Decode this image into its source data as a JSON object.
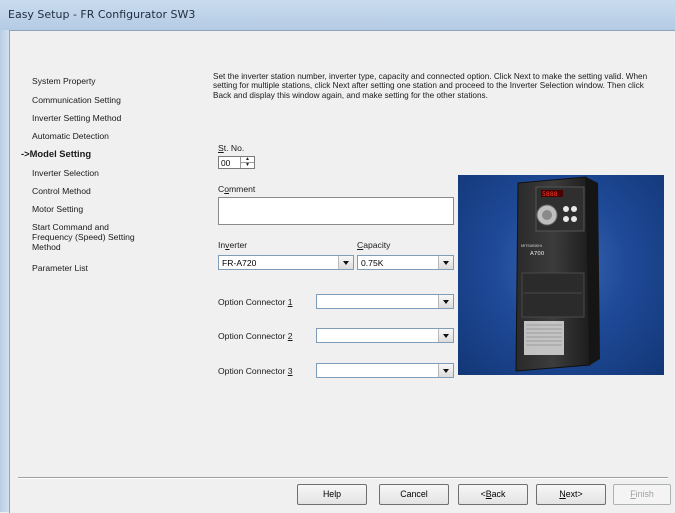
{
  "window": {
    "title": "Easy Setup - FR Configurator SW3"
  },
  "nav": {
    "items": [
      {
        "label": "System Property",
        "active": false
      },
      {
        "label": "Communication Setting",
        "active": false
      },
      {
        "label": "Inverter Setting Method",
        "active": false
      },
      {
        "label": "Automatic Detection",
        "active": false
      },
      {
        "label": "->Model Setting",
        "active": true
      },
      {
        "label": "Inverter Selection",
        "active": false
      },
      {
        "label": "Control Method",
        "active": false
      },
      {
        "label": "Motor Setting",
        "active": false
      },
      {
        "label": "Start Command and Frequency (Speed) Setting Method",
        "active": false
      },
      {
        "label": "Parameter List",
        "active": false
      }
    ]
  },
  "description": "Set the inverter station number, inverter type, capacity and connected option. Click Next to make the setting valid. When setting for multiple stations, click Next after setting one station and proceed to the Inverter Selection window. Then click Back and display this window again, and make setting for the other stations.",
  "form": {
    "st_no": {
      "label_underlined": "S",
      "label_rest": "t. No.",
      "value": "00"
    },
    "comment": {
      "label_pre": "C",
      "label_underlined": "o",
      "label_rest": "mment",
      "value": ""
    },
    "inverter": {
      "label_pre": "In",
      "label_underlined": "v",
      "label_rest": "erter",
      "value": "FR-A720"
    },
    "capacity": {
      "label_underlined": "C",
      "label_rest": "apacity",
      "value": "0.75K"
    },
    "options": [
      {
        "label_pre": "Option Connector ",
        "label_underlined": "1",
        "value": ""
      },
      {
        "label_pre": "Option Connector ",
        "label_underlined": "2",
        "value": ""
      },
      {
        "label_pre": "Option Connector ",
        "label_underlined": "3",
        "value": ""
      }
    ]
  },
  "photo": {
    "brand": "MITSUBISHI",
    "model": "A700",
    "display": "5888"
  },
  "buttons": {
    "help": "Help",
    "cancel": "Cancel",
    "back_pre": "<",
    "back_underlined": "B",
    "back_rest": "ack",
    "next_underlined": "N",
    "next_rest": "ext>",
    "finish_underlined": "F",
    "finish_rest": "inish"
  }
}
